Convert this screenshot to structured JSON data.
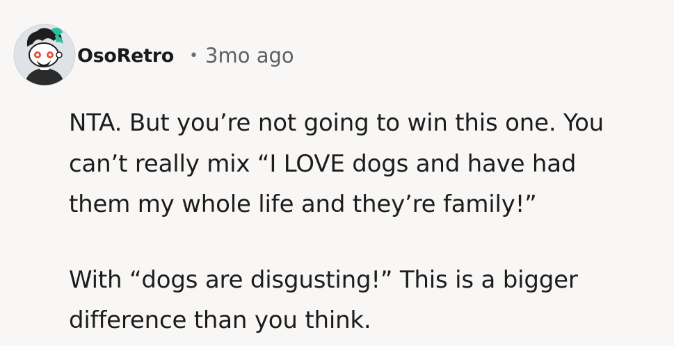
{
  "comment": {
    "author": "OsoRetro",
    "separator": "•",
    "time_ago": "3mo ago",
    "avatar": "reddit-snoo-avatar-icon",
    "paragraphs": [
      "NTA. But you’re not going to win this one. You\ncan’t really mix “I LOVE dogs and have had\nthem my whole life and they’re family!”",
      "With “dogs are disgusting!” This is a bigger\ndifference than you think."
    ]
  }
}
